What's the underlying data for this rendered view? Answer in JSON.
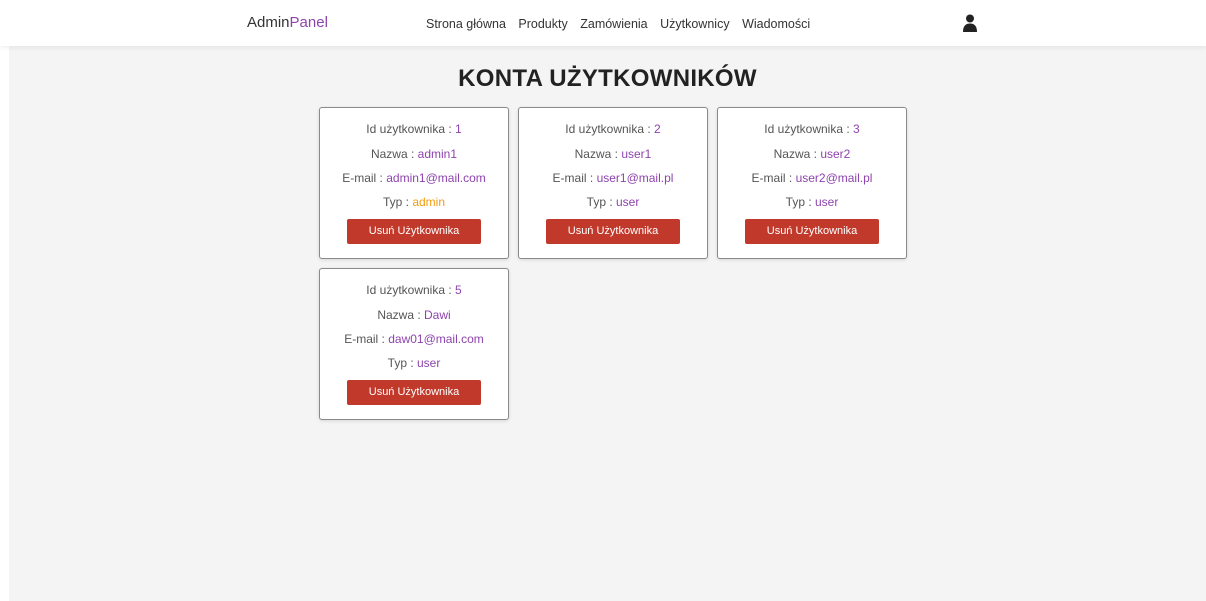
{
  "nav": {
    "brand_main": "Admin",
    "brand_accent": "Panel",
    "links": [
      "Strona główna",
      "Produkty",
      "Zamówienia",
      "Użytkownicy",
      "Wiadomości"
    ]
  },
  "page": {
    "title": "KONTA UŻYTKOWNIKÓW"
  },
  "labels": {
    "id": "Id użytkownika : ",
    "name": "Nazwa : ",
    "email": "E-mail : ",
    "type": "Typ : ",
    "delete": "Usuń Użytkownika"
  },
  "users": [
    {
      "id": "1",
      "name": "admin1",
      "email": "admin1@mail.com",
      "type": "admin"
    },
    {
      "id": "2",
      "name": "user1",
      "email": "user1@mail.pl",
      "type": "user"
    },
    {
      "id": "3",
      "name": "user2",
      "email": "user2@mail.pl",
      "type": "user"
    },
    {
      "id": "5",
      "name": "Dawi",
      "email": "daw01@mail.com",
      "type": "user"
    }
  ],
  "colors": {
    "accent": "#8e44ad",
    "admin": "#f39c12",
    "danger": "#c0392b",
    "background": "#f4f4f4"
  }
}
